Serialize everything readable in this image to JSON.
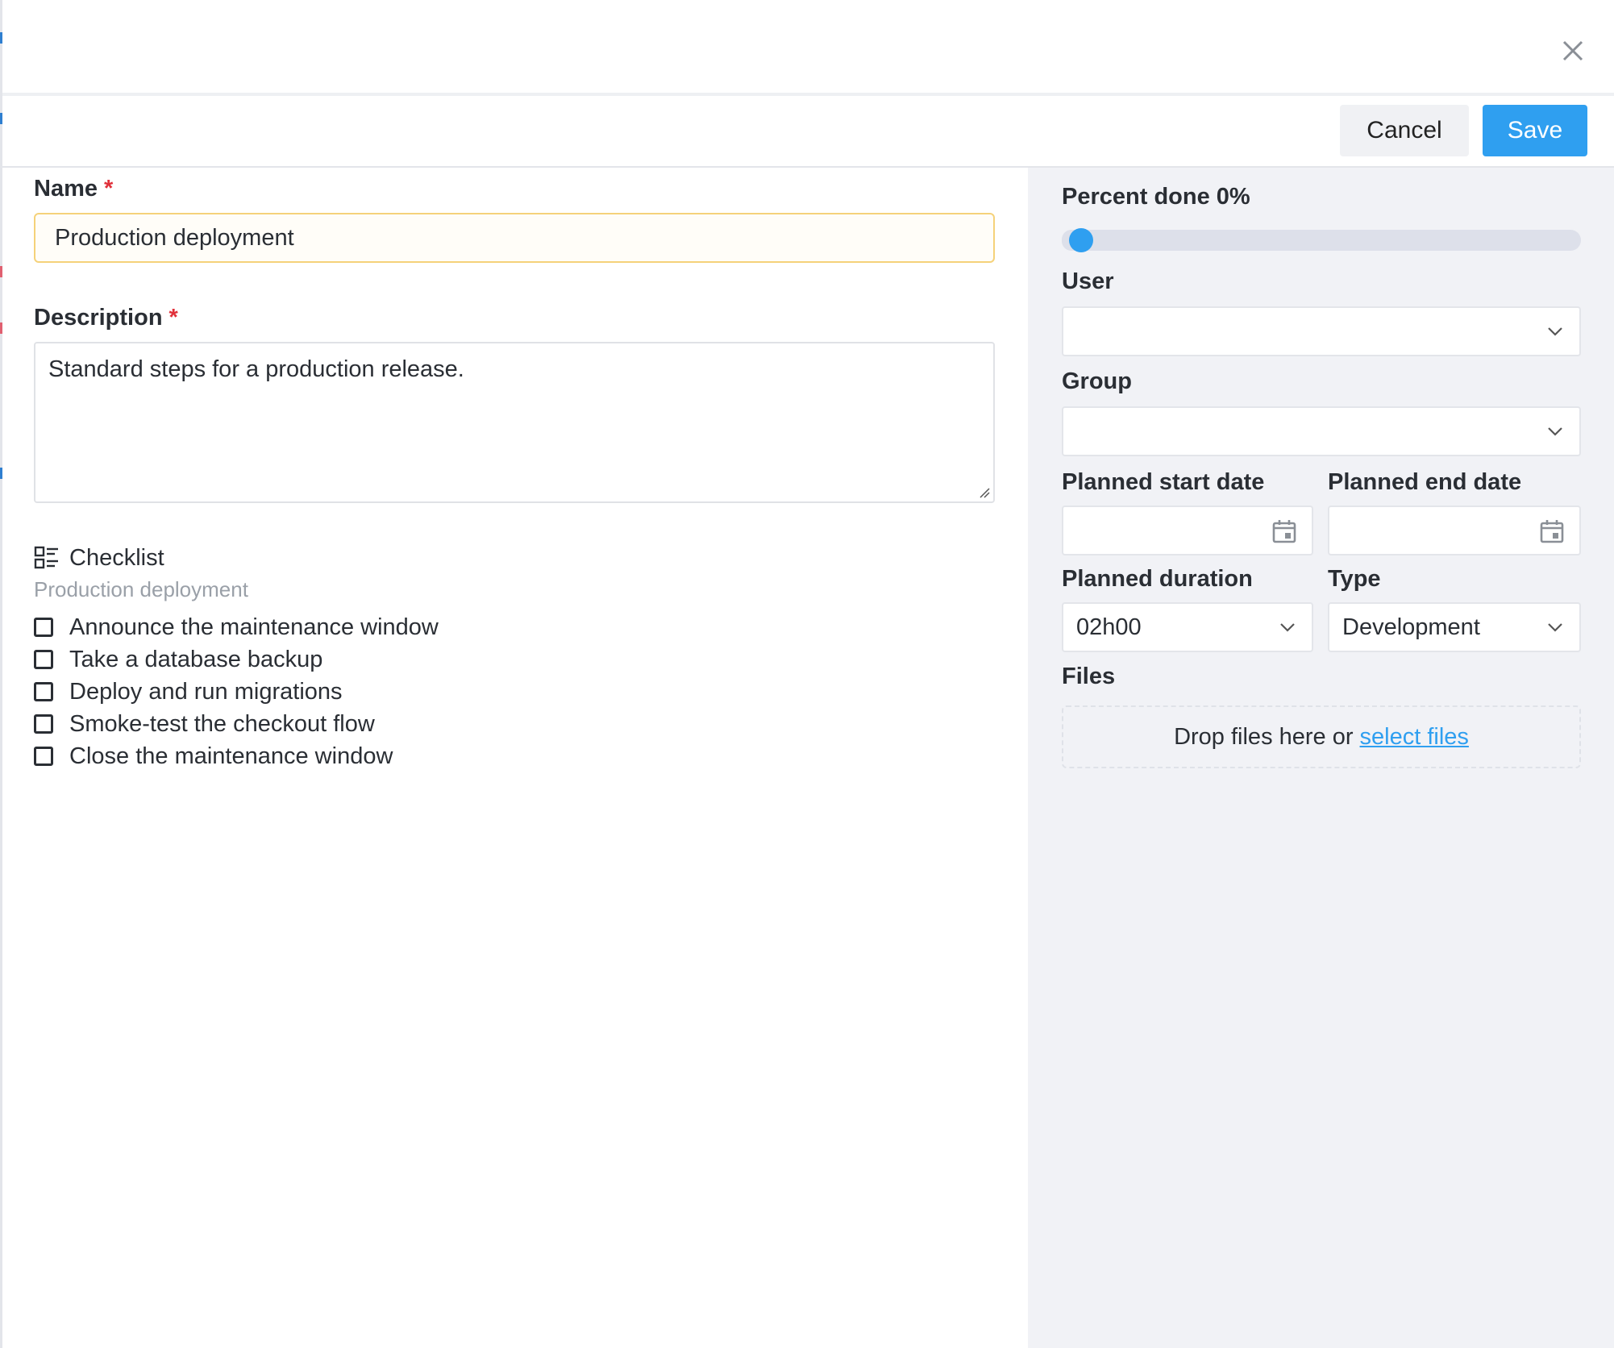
{
  "header": {
    "close_icon": "close-icon"
  },
  "toolbar": {
    "cancel_label": "Cancel",
    "save_label": "Save",
    "save_color": "#2f9ff0"
  },
  "form": {
    "name_label": "Name",
    "name_required": "*",
    "name_value": "Production deployment",
    "description_label": "Description",
    "description_required": "*",
    "description_value": "Standard steps for a production release."
  },
  "checklist": {
    "title": "Checklist",
    "icon": "checklist-icon",
    "subtitle": "Production deployment",
    "items": [
      {
        "label": "Announce the maintenance window",
        "checked": false
      },
      {
        "label": "Take a database backup",
        "checked": false
      },
      {
        "label": "Deploy and run migrations",
        "checked": false
      },
      {
        "label": "Smoke-test the checkout flow",
        "checked": false
      },
      {
        "label": "Close the maintenance window",
        "checked": false
      }
    ]
  },
  "sidebar": {
    "percent_label": "Percent done 0%",
    "percent_value": 0,
    "user_label": "User",
    "user_value": "",
    "group_label": "Group",
    "group_value": "",
    "start_date_label": "Planned start date",
    "start_date_value": "",
    "end_date_label": "Planned end date",
    "end_date_value": "",
    "duration_label": "Planned duration",
    "duration_value": "02h00",
    "type_label": "Type",
    "type_value": "Development",
    "files_label": "Files",
    "files_drop_text": "Drop files here or",
    "files_select_link": "select files"
  },
  "colors": {
    "accent": "#2f9ff0",
    "required": "#e0303a",
    "panel_bg": "#f1f2f6"
  }
}
